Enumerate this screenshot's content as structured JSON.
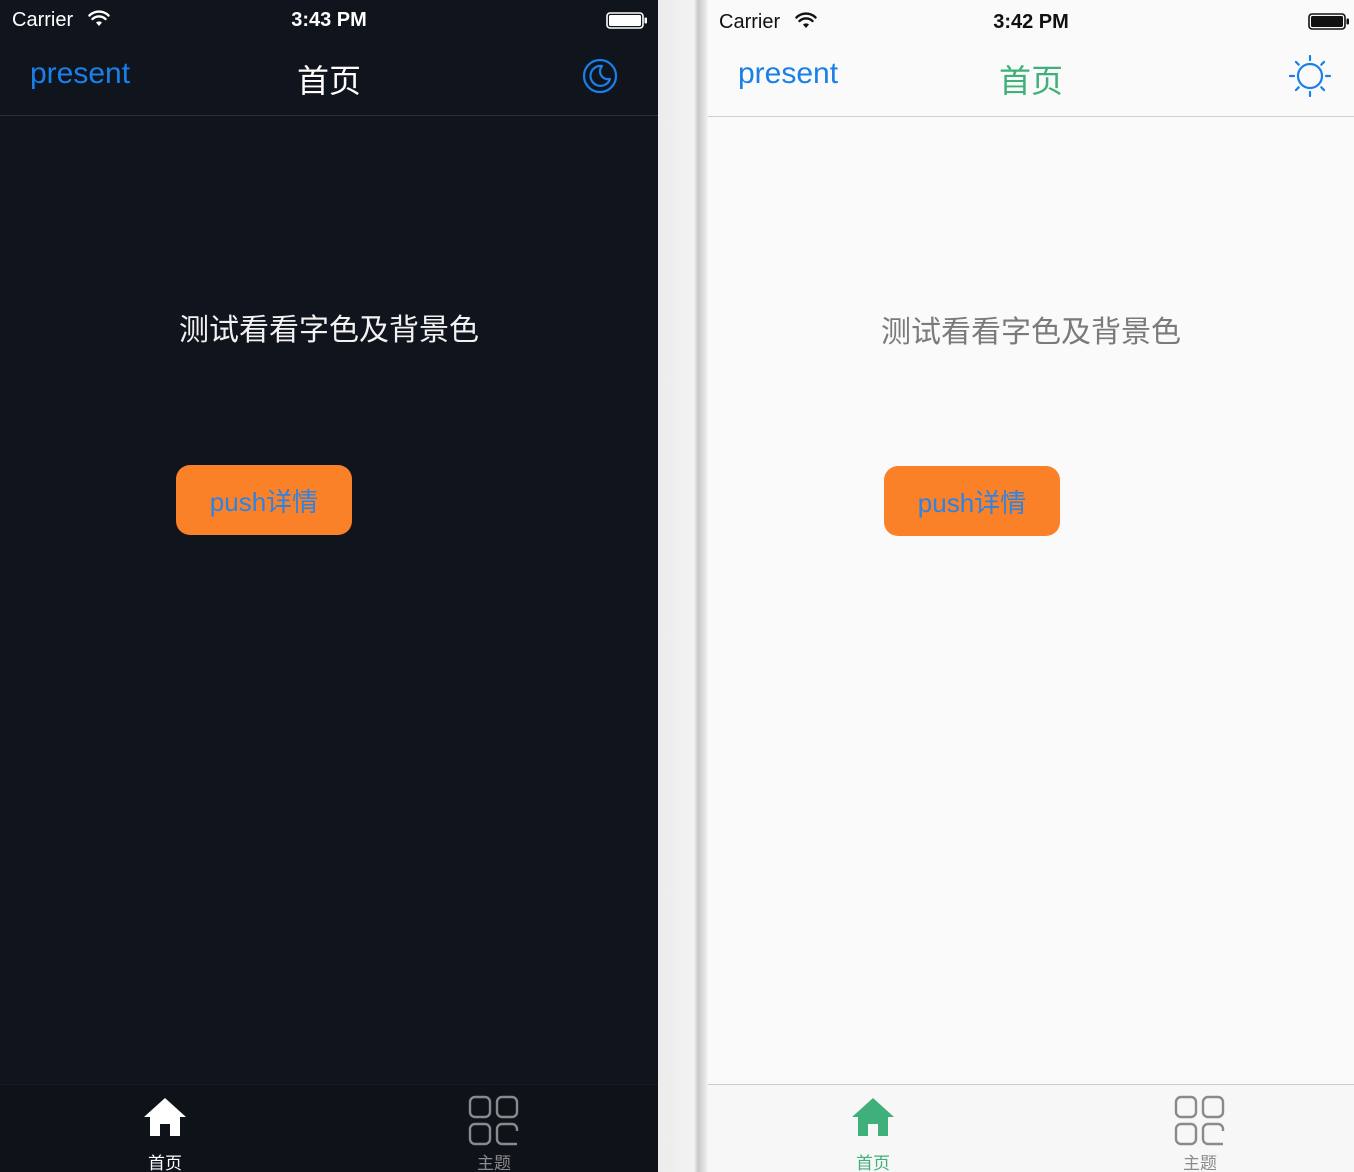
{
  "colors": {
    "dark_background": "#10141c",
    "light_background": "#fafafa",
    "nav_link_blue": "#1a7fe8",
    "accent_green": "#3fb07a",
    "button_orange": "#fa8128",
    "button_text_blue": "#2b83e6"
  },
  "dark_screen": {
    "status_bar": {
      "carrier": "Carrier",
      "time": "3:43 PM",
      "wifi_icon": "wifi-icon",
      "battery_icon": "battery-full-icon"
    },
    "nav_bar": {
      "left_button": "present",
      "title": "首页",
      "right_icon": "moon-icon"
    },
    "content": {
      "label": "测试看看字色及背景色",
      "button": "push详情"
    },
    "tab_bar": {
      "tabs": [
        {
          "label": "首页",
          "icon": "home-icon",
          "selected": true
        },
        {
          "label": "主题",
          "icon": "grid-icon",
          "selected": false
        }
      ]
    }
  },
  "light_screen": {
    "status_bar": {
      "carrier": "Carrier",
      "time": "3:42 PM",
      "wifi_icon": "wifi-icon",
      "battery_icon": "battery-full-icon"
    },
    "nav_bar": {
      "left_button": "present",
      "title": "首页",
      "right_icon": "sun-icon"
    },
    "content": {
      "label": "测试看看字色及背景色",
      "button": "push详情"
    },
    "tab_bar": {
      "tabs": [
        {
          "label": "首页",
          "icon": "home-icon",
          "selected": true
        },
        {
          "label": "主题",
          "icon": "grid-icon",
          "selected": false
        }
      ]
    }
  }
}
